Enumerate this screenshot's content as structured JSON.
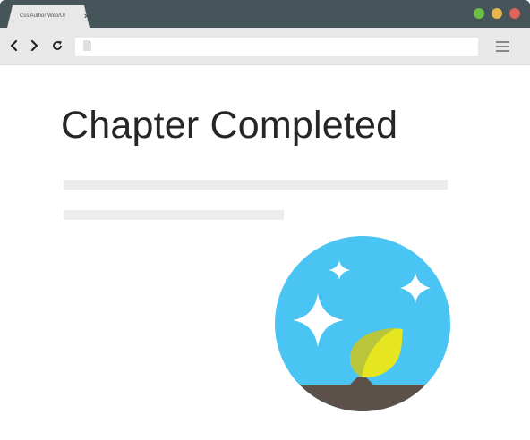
{
  "browser": {
    "active_tab_title": "Css Author  Web/UI",
    "close_symbol": "×",
    "inactive_tab_title": "",
    "window_buttons": [
      {
        "name": "maximize-button",
        "color": "#6cbe45"
      },
      {
        "name": "minimize-button",
        "color": "#e6b64c"
      },
      {
        "name": "close-window-button",
        "color": "#e0635a"
      }
    ],
    "address_value": "",
    "icons": [
      "back-arrow-icon",
      "forward-arrow-icon",
      "reload-icon",
      "document-icon",
      "hamburger-menu-icon"
    ]
  },
  "page": {
    "heading": "Chapter Completed",
    "badge": {
      "icon": "chapter-completed-badge",
      "colors": {
        "sky": "#4ac4f3",
        "ground": "#5b504a",
        "leaf_light": "#e5e520",
        "leaf_dark": "#b9c53b",
        "star": "#ffffff"
      }
    }
  }
}
